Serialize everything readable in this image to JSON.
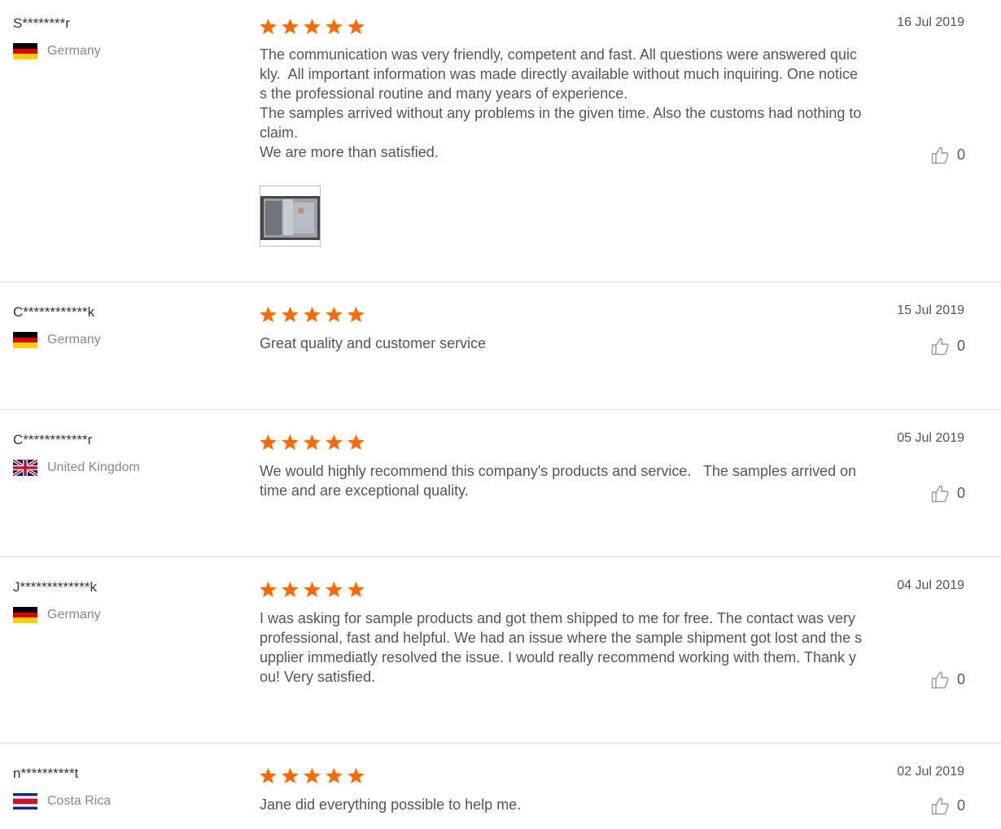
{
  "reviews": [
    {
      "buyer": "S********r",
      "country": "Germany",
      "flag": "germany-flag",
      "rating": 5,
      "date": "16 Jul 2019",
      "text": "The communication was very friendly, competent and fast. All questions were answered quickly.  All important information was made directly available without much inquiring. One notices the professional routine and many years of experience.\nThe samples arrived without any problems in the given time. Also the customs had nothing to claim.\nWe are more than satisfied.",
      "likes": "0",
      "has_photo": true
    },
    {
      "buyer": "C************k",
      "country": "Germany",
      "flag": "germany-flag",
      "rating": 5,
      "date": "15 Jul 2019",
      "text": "Great quality and customer service",
      "likes": "0"
    },
    {
      "buyer": "C************r",
      "country": "United Kingdom",
      "flag": "united-kingdom-flag",
      "rating": 5,
      "date": "05 Jul 2019",
      "text": "We would highly recommend this company's products and service.   The samples arrived on time and are exceptional quality.",
      "likes": "0"
    },
    {
      "buyer": "J*************k",
      "country": "Germany",
      "flag": "germany-flag",
      "rating": 5,
      "date": "04 Jul 2019",
      "text": "I was asking for sample products and got them shipped to me for free. The contact was very professional, fast and helpful. We had an issue where the sample shipment got lost and the supplier immediatly resolved the issue. I would really recommend working with them. Thank you! Very satisfied.",
      "likes": "0"
    },
    {
      "buyer": "n**********t",
      "country": "Costa Rica",
      "flag": "costa-rica-flag",
      "rating": 5,
      "date": "02 Jul 2019",
      "text": "Jane did everything possible to help me.",
      "likes": "0"
    }
  ],
  "colors": {
    "star": "#ff6a00",
    "divider": "#dedede",
    "country_text": "#888888",
    "body_text": "#555555"
  },
  "icons": {
    "rating": "star-icon",
    "like": "thumbs-up-icon"
  }
}
